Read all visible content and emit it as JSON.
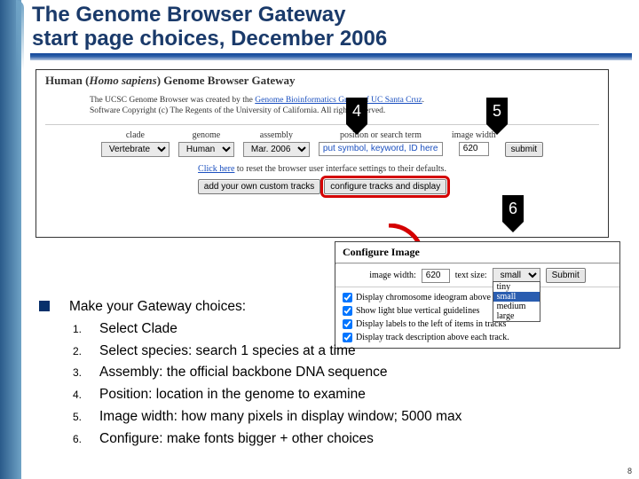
{
  "title_line1": "The Genome Browser Gateway",
  "title_line2": "start page choices, December 2006",
  "screenshot": {
    "header_pre": "Human (",
    "header_italic": "Homo sapiens",
    "header_post": ") Genome Browser Gateway",
    "desc_pre": "The UCSC Genome Browser was created by the ",
    "desc_link1": "Genome Bioinformatics Group of UC Santa Cruz",
    "desc_mid": ".",
    "desc2": "Software Copyright (c) The Regents of the University of California. All rights reserved.",
    "labels": {
      "clade": "clade",
      "genome": "genome",
      "assembly": "assembly",
      "position": "position or search term",
      "width": "image width"
    },
    "values": {
      "clade": "Vertebrate",
      "genome": "Human",
      "assembly": "Mar. 2006",
      "position_placeholder": "put symbol, keyword, ID here",
      "width": "620",
      "submit": "submit"
    },
    "reset_pre": "Click here",
    "reset_post": " to reset the browser user interface settings to their defaults.",
    "buttons": {
      "custom": "add your own custom tracks",
      "configure": "configure tracks and display"
    }
  },
  "callouts": {
    "c4": "4",
    "c5": "5",
    "c6": "6"
  },
  "config": {
    "title": "Configure Image",
    "img_width_label": "image width:",
    "img_width_value": "620",
    "text_size_label": "text size:",
    "text_size_value": "small",
    "submit": "Submit",
    "drop": {
      "tiny": "tiny",
      "small": "small",
      "medium": "medium",
      "large": "large"
    },
    "opts": [
      "Display chromosome ideogram above main graphic",
      "Show light blue vertical guidelines",
      "Display labels to the left of items in tracks",
      "Display track description above each track."
    ]
  },
  "bullets": {
    "lead": "Make your Gateway choices:",
    "items": [
      "Select Clade",
      "Select species: search 1 species at a time",
      "Assembly: the official backbone DNA sequence",
      "Position: location in the genome to examine",
      "Image width: how many pixels in display window; 5000 max",
      "Configure: make fonts bigger + other choices"
    ]
  },
  "page_number": "8"
}
